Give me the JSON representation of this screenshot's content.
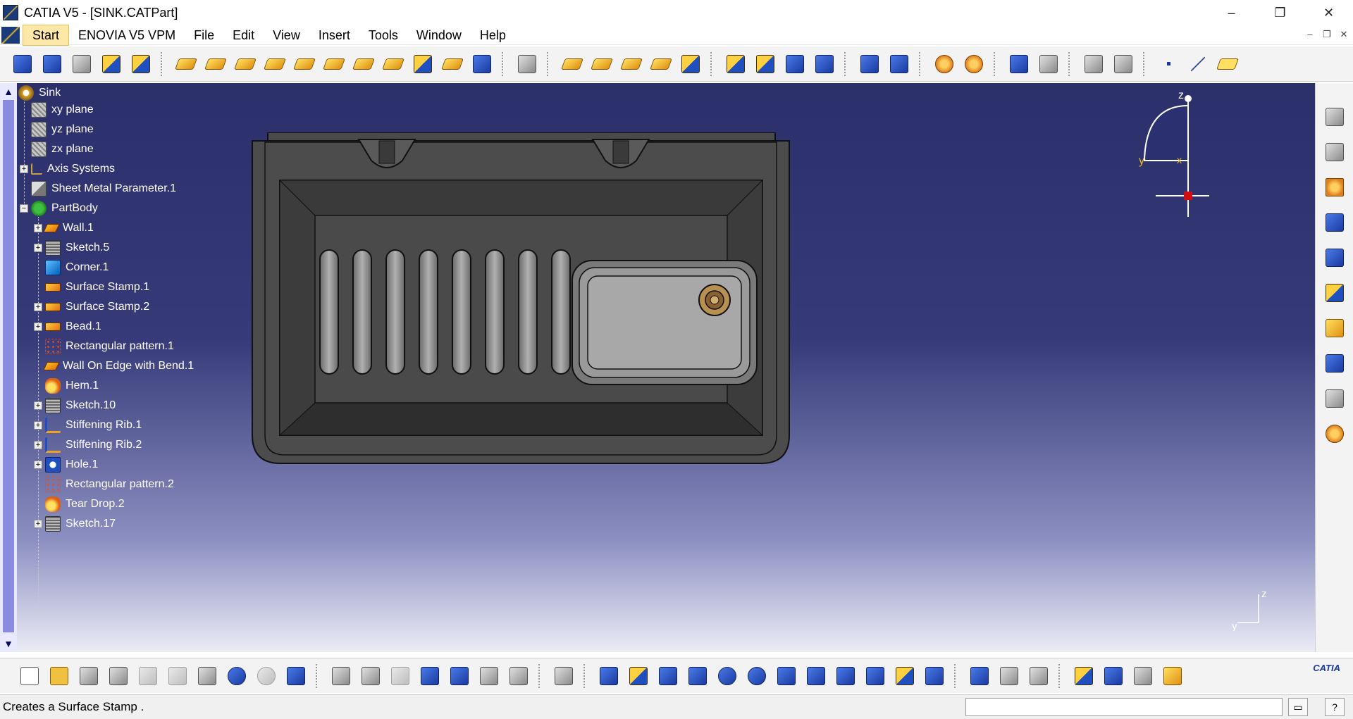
{
  "window": {
    "title": "CATIA V5 - [SINK.CATPart]",
    "controls": [
      "–",
      "❐",
      "✕"
    ]
  },
  "menu": {
    "items": [
      "Start",
      "ENOVIA V5 VPM",
      "File",
      "Edit",
      "View",
      "Insert",
      "Tools",
      "Window",
      "Help"
    ],
    "mdi_controls": [
      "–",
      "❐",
      "✕"
    ]
  },
  "tree": {
    "root": "Sink",
    "nodes": [
      {
        "label": "xy plane",
        "icon": "plane-icon"
      },
      {
        "label": "yz plane",
        "icon": "plane-icon"
      },
      {
        "label": "zx plane",
        "icon": "plane-icon"
      },
      {
        "label": "Axis Systems",
        "icon": "axis-icon"
      },
      {
        "label": "Sheet Metal Parameter.1",
        "icon": "sheet-metal-param-icon"
      },
      {
        "label": "PartBody",
        "icon": "partbody-icon"
      },
      {
        "label": "Wall.1",
        "icon": "wall-icon"
      },
      {
        "label": "Sketch.5",
        "icon": "sketch-icon"
      },
      {
        "label": "Corner.1",
        "icon": "corner-icon"
      },
      {
        "label": "Surface Stamp.1",
        "icon": "surface-stamp-icon"
      },
      {
        "label": "Surface Stamp.2",
        "icon": "surface-stamp-icon"
      },
      {
        "label": "Bead.1",
        "icon": "bead-icon"
      },
      {
        "label": "Rectangular pattern.1",
        "icon": "rectangular-pattern-icon"
      },
      {
        "label": "Wall On Edge with Bend.1",
        "icon": "wall-on-edge-icon"
      },
      {
        "label": "Hem.1",
        "icon": "hem-icon"
      },
      {
        "label": "Sketch.10",
        "icon": "sketch-icon"
      },
      {
        "label": "Stiffening Rib.1",
        "icon": "stiffening-rib-icon"
      },
      {
        "label": "Stiffening Rib.2",
        "icon": "stiffening-rib-icon"
      },
      {
        "label": "Hole.1",
        "icon": "hole-icon"
      },
      {
        "label": "Rectangular pattern.2",
        "icon": "rectangular-pattern-icon"
      },
      {
        "label": "Tear Drop.2",
        "icon": "tear-drop-icon"
      },
      {
        "label": "Sketch.17",
        "icon": "sketch-icon"
      }
    ]
  },
  "compass": {
    "z": "z",
    "y": "y",
    "x": "x"
  },
  "mini_axis": {
    "z": "z",
    "y": "y"
  },
  "bottom_toolbar": {
    "brand": "CATIA"
  },
  "status": {
    "message": "Creates a Surface Stamp ."
  }
}
